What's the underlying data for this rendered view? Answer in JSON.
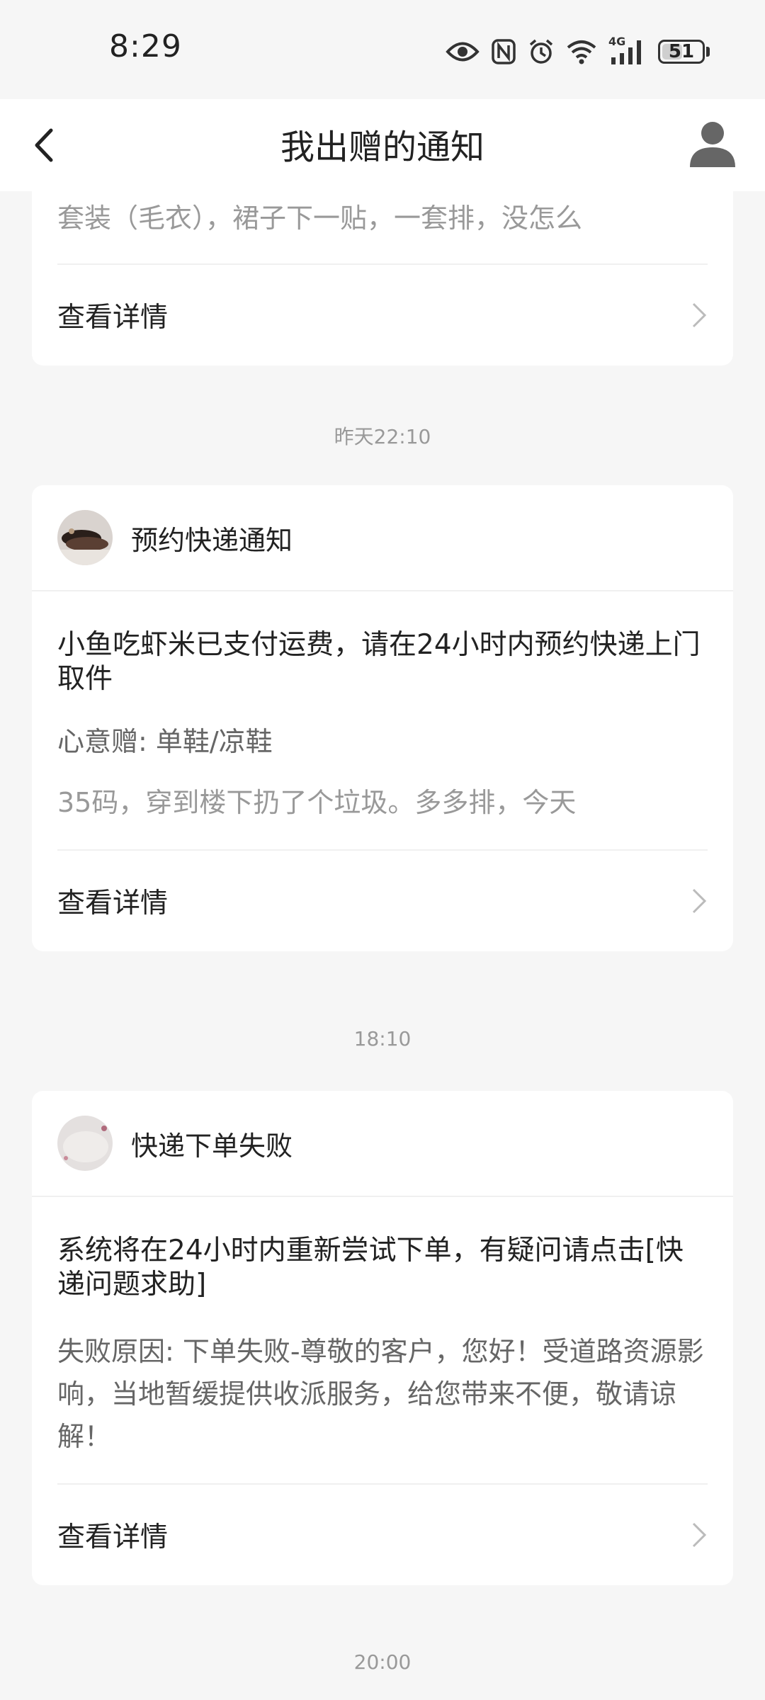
{
  "status_bar": {
    "time": "8:29",
    "network": "4G",
    "battery": "51",
    "battery_level_percent": 51,
    "icons": [
      "eye-icon",
      "nfc-icon",
      "alarm-icon",
      "wifi-icon",
      "signal-icon",
      "battery-icon"
    ]
  },
  "header": {
    "title": "我出赠的通知",
    "back_icon": "back-arrow-icon",
    "profile_icon": "profile-icon"
  },
  "notifications": [
    {
      "partial": true,
      "desc": "套装（毛衣），裙子下一贴，一套排，没怎么",
      "detail_label": "查看详情"
    },
    {
      "time": "昨天22:10",
      "title": "预约快递通知",
      "message": "小鱼吃虾米已支付运费，请在24小时内预约快递上门取件",
      "meta": "心意赠: 单鞋/凉鞋",
      "desc": "35码，穿到楼下扔了个垃圾。多多排，今天",
      "detail_label": "查看详情"
    },
    {
      "time": "18:10",
      "title": "快递下单失败",
      "message": "系统将在24小时内重新尝试下单，有疑问请点击[快递问题求助]",
      "reason": "失败原因: 下单失败-尊敬的客户，您好！受道路资源影响，当地暂缓提供收派服务，给您带来不便，敬请谅解！",
      "detail_label": "查看详情"
    },
    {
      "time": "20:00"
    }
  ],
  "colors": {
    "background": "#f6f6f6",
    "card": "#ffffff",
    "primary_text": "#222222",
    "secondary_text": "#666666",
    "muted_text": "#999999"
  }
}
